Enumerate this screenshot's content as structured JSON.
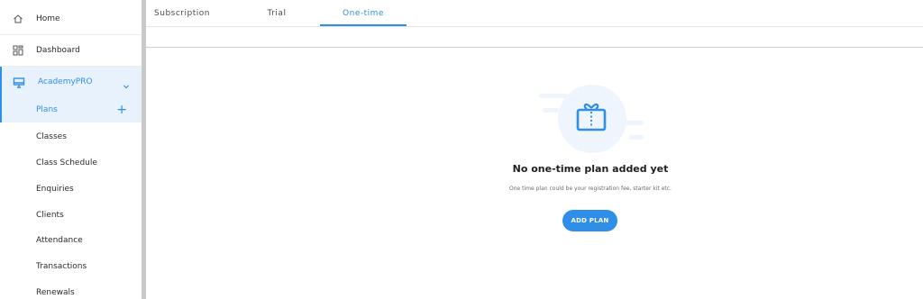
{
  "sidebar": {
    "home_label": "Home",
    "dashboard_label": "Dashboard",
    "academy_label": "AcademyPRO",
    "plans_label": "Plans",
    "items": [
      {
        "label": "Classes"
      },
      {
        "label": "Class Schedule"
      },
      {
        "label": "Enquiries"
      },
      {
        "label": "Clients"
      },
      {
        "label": "Attendance"
      },
      {
        "label": "Transactions"
      },
      {
        "label": "Renewals"
      }
    ]
  },
  "tabs": [
    {
      "label": "Subscription",
      "active": false
    },
    {
      "label": "Trial",
      "active": false
    },
    {
      "label": "One-time",
      "active": true
    }
  ],
  "empty_state": {
    "title": "No one-time plan added yet",
    "subtitle": "One time plan could be your registration fee, starter kit etc.",
    "button_label": "ADD PLAN",
    "icon": "gift-box-icon"
  },
  "colors": {
    "accent": "#2f8fe8",
    "active_bg": "#e7f2fd",
    "divider": "#c9c9c9"
  }
}
